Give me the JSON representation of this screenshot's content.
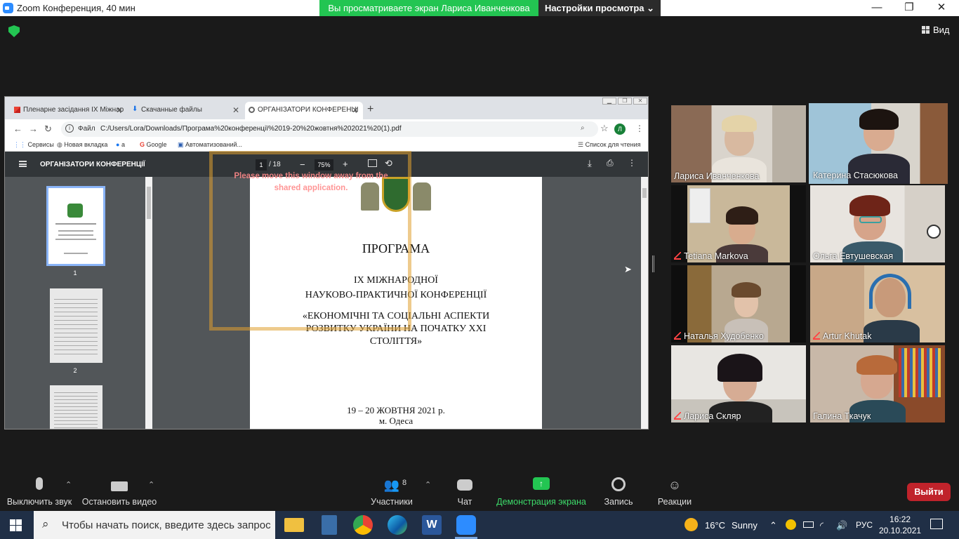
{
  "zoom_window": {
    "title": "Zoom Конференция, 40 мин",
    "share_banner": "Вы просматриваете экран Лариса Иванченкова",
    "view_options": "Настройки просмотра",
    "view_button": "Вид"
  },
  "browser": {
    "tabs": [
      {
        "label": "Пленарне засідання IX Міжнар"
      },
      {
        "label": "Скачанные файлы"
      },
      {
        "label": "ОРГАНІЗАТОРИ КОНФЕРЕНЦІ"
      }
    ],
    "scheme_label": "Файл",
    "url": "C:/Users/Lora/Downloads/Програма%20конференції%2019-20%20жовтня%202021%20(1).pdf",
    "profile_initial": "Л",
    "bookmarks": [
      "Сервисы",
      "Новая вкладка",
      "а",
      "Google",
      "Автоматизований...",
      "Список для чтения"
    ],
    "pdf": {
      "title": "ОРГАНІЗАТОРИ КОНФЕРЕНЦІЇ",
      "page_current": "1",
      "page_total": "/ 18",
      "zoom": "75%",
      "thumb_numbers": [
        "1",
        "2"
      ],
      "page_lines": {
        "heading": "ПРОГРАМА",
        "line1": "IX МІЖНАРОДНОЇ",
        "line2": "НАУКОВО-ПРАКТИЧНОЇ КОНФЕРЕНЦІЇ",
        "line3": "«ЕКОНОМІЧНІ ТА СОЦІАЛЬНІ АСПЕКТИ",
        "line4": "РОЗВИТКУ УКРАЇНИ НА ПОЧАТКУ XXI",
        "line5": "СТОЛІТТЯ»",
        "date": "19 – 20 ЖОВТНЯ 2021 р.",
        "city": "м. Одеса"
      }
    },
    "overlay_message": "Please move this window away from the shared application."
  },
  "participants": [
    {
      "name": "Лариса Иванченкова",
      "muted": false
    },
    {
      "name": "Катерина Стасюкова",
      "muted": false,
      "speaking": true
    },
    {
      "name": "Tetiana Markova",
      "muted": true
    },
    {
      "name": "Ольга Евтушевская",
      "muted": false
    },
    {
      "name": "Наталья Худобенко",
      "muted": true
    },
    {
      "name": "Artur Khutak",
      "muted": true
    },
    {
      "name": "Лариса Скляр",
      "muted": true
    },
    {
      "name": "Галина Ткачук",
      "muted": false
    }
  ],
  "toolbar": {
    "mute": "Выключить звук",
    "video": "Остановить видео",
    "participants": "Участники",
    "participants_count": "8",
    "chat": "Чат",
    "share": "Демонстрация экрана",
    "record": "Запись",
    "reactions": "Реакции",
    "leave": "Выйти"
  },
  "taskbar": {
    "search_placeholder": "Чтобы начать поиск, введите здесь запрос",
    "weather_temp": "16°C",
    "weather_desc": "Sunny",
    "language": "РУС",
    "time": "16:22",
    "date": "20.10.2021"
  },
  "colors": {
    "zoom_green": "#23c552",
    "leave_red": "#c0232b",
    "speaker_border": "#d8f05a",
    "taskbar": "#202f46"
  }
}
